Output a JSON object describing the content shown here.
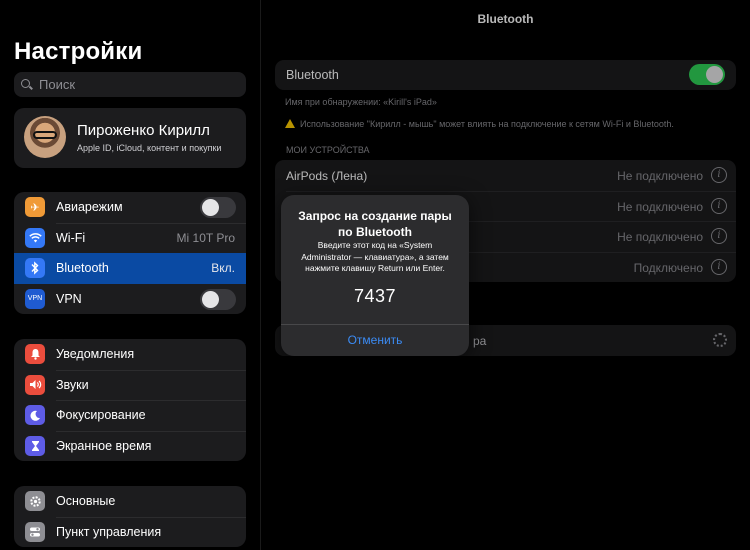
{
  "sidebar": {
    "title": "Настройки",
    "search_placeholder": "Поиск",
    "profile": {
      "name": "Пироженко Кирилл",
      "subtitle": "Apple ID, iCloud, контент и покупки"
    },
    "group1": [
      {
        "label": "Авиарежим",
        "icon": "airplane-icon",
        "color": "#f09a37",
        "toggle": "off"
      },
      {
        "label": "Wi-Fi",
        "icon": "wifi-icon",
        "color": "#3478f6",
        "value": "Mi 10T Pro"
      },
      {
        "label": "Bluetooth",
        "icon": "bluetooth-icon",
        "color": "#3478f6",
        "value": "Вкл.",
        "selected": true
      },
      {
        "label": "VPN",
        "icon": "vpn-icon",
        "color": "#1f5bd1",
        "toggle": "off",
        "icon_text": "VPN"
      }
    ],
    "group2": [
      {
        "label": "Уведомления",
        "icon": "bell-icon",
        "color": "#eb4d3d"
      },
      {
        "label": "Звуки",
        "icon": "speaker-icon",
        "color": "#eb4d3d"
      },
      {
        "label": "Фокусирование",
        "icon": "moon-icon",
        "color": "#5e5ce6"
      },
      {
        "label": "Экранное время",
        "icon": "hourglass-icon",
        "color": "#5e5ce6"
      }
    ],
    "group3": [
      {
        "label": "Основные",
        "icon": "gear-icon",
        "color": "#8e8e93"
      },
      {
        "label": "Пункт управления",
        "icon": "switches-icon",
        "color": "#8e8e93"
      }
    ]
  },
  "pane": {
    "nav_title": "Bluetooth",
    "bt_label": "Bluetooth",
    "bt_toggle": "on",
    "discovery_note": "Имя при обнаружении: «Kirill's iPad»",
    "warning_note": "Использование \"Кирилл - мышь\" может влиять на подключение к сетям Wi-Fi и Bluetooth.",
    "section_header": "МОИ УСТРОЙСТВА",
    "devices": [
      {
        "name": "AirPods (Лена)",
        "status": "Не подключено"
      },
      {
        "name": "",
        "status": "Не подключено"
      },
      {
        "name": "",
        "status": "Не подключено"
      },
      {
        "name": "",
        "status": "Подключено"
      }
    ],
    "other_tail": "ра"
  },
  "alert": {
    "title": "Запрос на создание пары по Bluetooth",
    "message": "Введите этот код на «System Administrator — клавиатура», а затем нажмите клавишу Return или Enter.",
    "code": "7437",
    "cancel": "Отменить"
  }
}
